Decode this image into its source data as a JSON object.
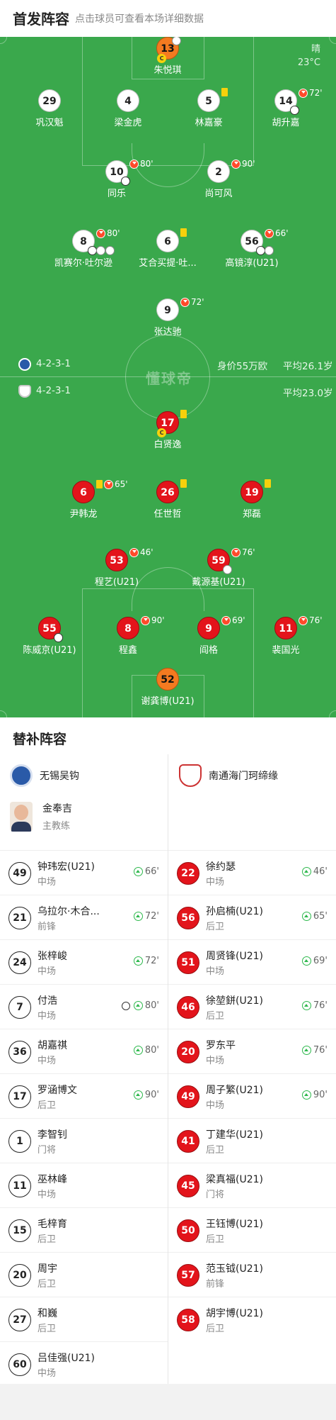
{
  "header": {
    "title": "首发阵容",
    "subtitle": "点击球员可查看本场详细数据"
  },
  "pitch": {
    "weather": "晴",
    "temperature": "23°C",
    "watermark": "懂球帝",
    "home_formation": "4-2-3-1",
    "home_value": "身价55万欧",
    "home_age": "平均26.1岁",
    "away_formation": "4-2-3-1",
    "away_age": "平均23.0岁"
  },
  "home_players": [
    {
      "num": "13",
      "name": "朱悦琪"
    },
    {
      "num": "29",
      "name": "巩汉魁"
    },
    {
      "num": "4",
      "name": "梁金虎"
    },
    {
      "num": "5",
      "name": "林嘉豪"
    },
    {
      "num": "14",
      "name": "胡升嘉",
      "min": "72'"
    },
    {
      "num": "10",
      "name": "同乐",
      "min": "80'"
    },
    {
      "num": "2",
      "name": "尚可风",
      "min": "90'"
    },
    {
      "num": "8",
      "name": "凯赛尔·吐尔逊",
      "min": "80'"
    },
    {
      "num": "6",
      "name": "艾合买提·吐..."
    },
    {
      "num": "56",
      "name": "高镜淳(U21)",
      "min": "66'"
    },
    {
      "num": "9",
      "name": "张达驰",
      "min": "72'"
    }
  ],
  "away_players": [
    {
      "num": "17",
      "name": "白贤逸"
    },
    {
      "num": "6",
      "name": "尹韩龙",
      "min": "65'"
    },
    {
      "num": "26",
      "name": "任世哲"
    },
    {
      "num": "19",
      "name": "郑磊"
    },
    {
      "num": "53",
      "name": "程艺(U21)",
      "min": "46'"
    },
    {
      "num": "59",
      "name": "戴源基(U21)",
      "min": "76'"
    },
    {
      "num": "55",
      "name": "陈威京(U21)"
    },
    {
      "num": "8",
      "name": "程鑫",
      "min": "90'"
    },
    {
      "num": "9",
      "name": "阎格",
      "min": "69'"
    },
    {
      "num": "11",
      "name": "裴国光",
      "min": "76'"
    },
    {
      "num": "52",
      "name": "谢龚博(U21)"
    }
  ],
  "captain_mark": "C",
  "bench": {
    "title": "替补阵容",
    "home_team": "无锡吴钩",
    "away_team": "南通海门珂缔缘",
    "coach_name": "金奉吉",
    "coach_role": "主教练",
    "home": [
      {
        "num": "49",
        "name": "钟玮宏(U21)",
        "pos": "中场",
        "min": "66'"
      },
      {
        "num": "21",
        "name": "乌拉尔·木合...",
        "pos": "前锋",
        "min": "72'"
      },
      {
        "num": "24",
        "name": "张梓峻",
        "pos": "中场",
        "min": "72'"
      },
      {
        "num": "7",
        "name": "付浩",
        "pos": "中场",
        "min": "80'"
      },
      {
        "num": "36",
        "name": "胡嘉祺",
        "pos": "中场",
        "min": "80'"
      },
      {
        "num": "17",
        "name": "罗涵博文",
        "pos": "后卫",
        "min": "90'"
      },
      {
        "num": "1",
        "name": "李智钊",
        "pos": "门将"
      },
      {
        "num": "11",
        "name": "巫林峰",
        "pos": "中场"
      },
      {
        "num": "15",
        "name": "毛梓育",
        "pos": "后卫"
      },
      {
        "num": "20",
        "name": "周宇",
        "pos": "后卫"
      },
      {
        "num": "27",
        "name": "和巍",
        "pos": "后卫"
      },
      {
        "num": "60",
        "name": "吕佳强(U21)",
        "pos": "中场"
      }
    ],
    "away": [
      {
        "num": "22",
        "name": "徐约瑟",
        "pos": "中场",
        "min": "46'"
      },
      {
        "num": "56",
        "name": "孙启楠(U21)",
        "pos": "后卫",
        "min": "65'"
      },
      {
        "num": "51",
        "name": "周贤锋(U21)",
        "pos": "中场",
        "min": "69'"
      },
      {
        "num": "46",
        "name": "徐堃鉼(U21)",
        "pos": "后卫",
        "min": "76'"
      },
      {
        "num": "20",
        "name": "罗东平",
        "pos": "中场",
        "min": "76'"
      },
      {
        "num": "49",
        "name": "周子繁(U21)",
        "pos": "中场",
        "min": "90'"
      },
      {
        "num": "41",
        "name": "丁建华(U21)",
        "pos": "后卫"
      },
      {
        "num": "45",
        "name": "梁真福(U21)",
        "pos": "门将"
      },
      {
        "num": "50",
        "name": "王钰博(U21)",
        "pos": "后卫"
      },
      {
        "num": "57",
        "name": "范玉钺(U21)",
        "pos": "前锋"
      },
      {
        "num": "58",
        "name": "胡宇博(U21)",
        "pos": "后卫"
      }
    ]
  }
}
